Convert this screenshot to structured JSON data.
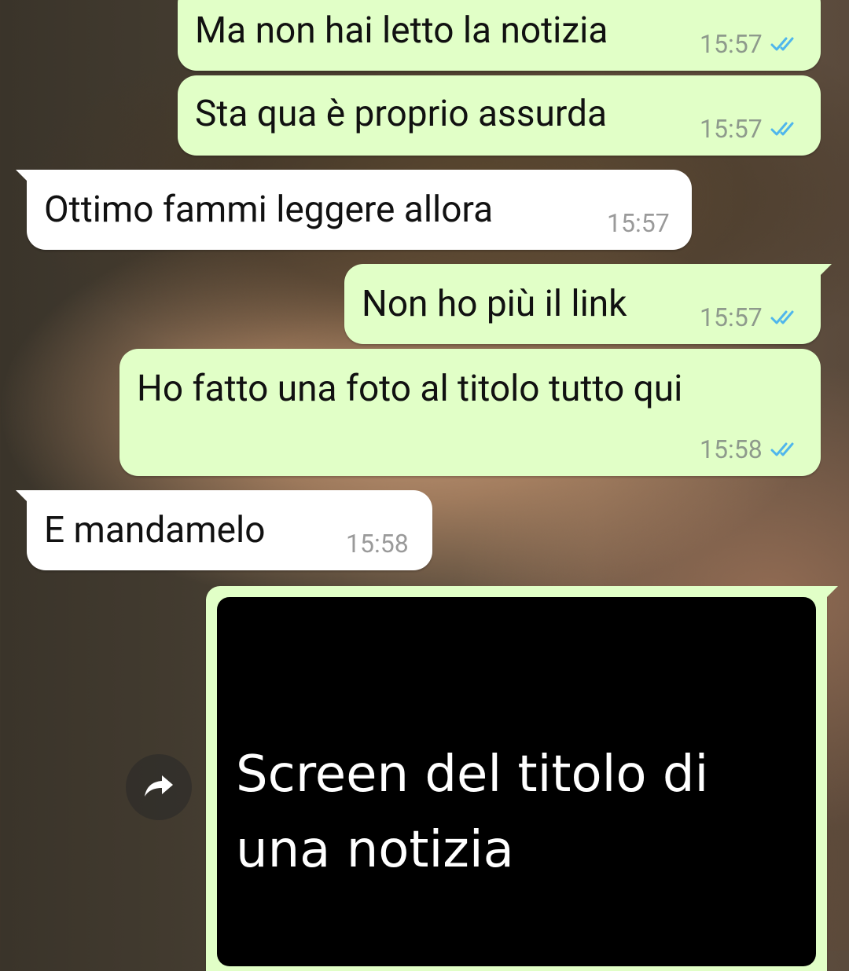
{
  "messages": [
    {
      "direction": "out",
      "text": "Ma non hai letto la notizia",
      "time": "15:57",
      "status": "read"
    },
    {
      "direction": "out",
      "text": "Sta qua è proprio assurda",
      "time": "15:57",
      "status": "read"
    },
    {
      "direction": "in",
      "text": "Ottimo fammi leggere allora",
      "time": "15:57"
    },
    {
      "direction": "out",
      "text": "Non ho più il link",
      "time": "15:57",
      "status": "read"
    },
    {
      "direction": "out",
      "text": "Ho fatto una foto al titolo tutto qui",
      "time": "15:58",
      "status": "read"
    },
    {
      "direction": "in",
      "text": "E mandamelo",
      "time": "15:58"
    }
  ],
  "image_message": {
    "caption": "Screen del titolo di una notizia"
  },
  "icons": {
    "read_ticks": "double-check-icon",
    "forward": "forward-arrow-icon"
  },
  "colors": {
    "outgoing_bubble": "#e1ffc7",
    "incoming_bubble": "#ffffff",
    "read_tick": "#4fb6ec",
    "timestamp": "#8e9a8c"
  }
}
